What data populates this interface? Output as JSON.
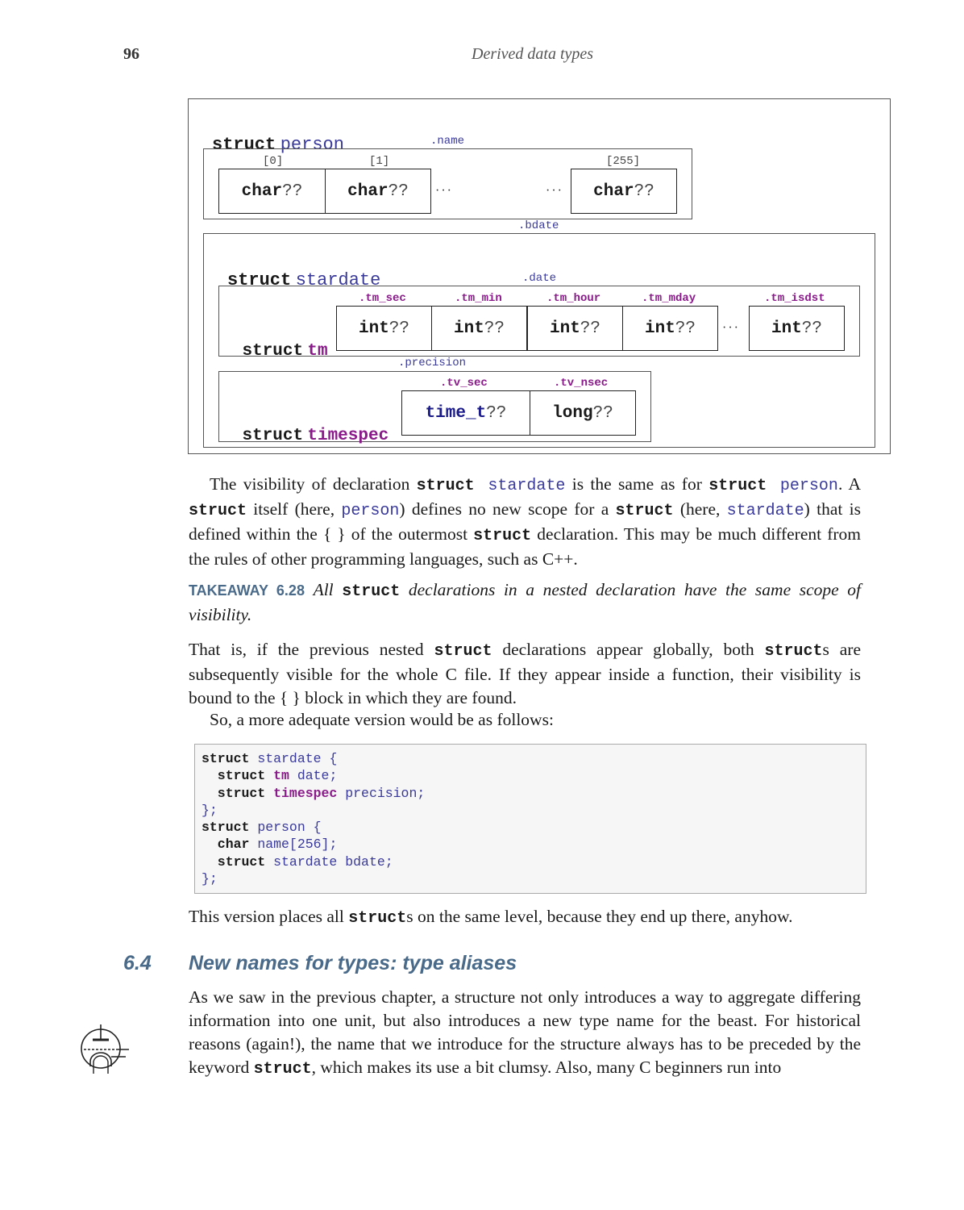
{
  "header": {
    "page_number": "96",
    "chapter_title": "Derived data types"
  },
  "diagram": {
    "outer_struct": {
      "keyword": "struct",
      "name": "person"
    },
    "name_field": {
      "label": ".name",
      "indices": [
        "[0]",
        "[1]",
        "[255]"
      ],
      "cells": [
        {
          "type": "char",
          "value": "??"
        },
        {
          "type": "char",
          "value": "??"
        },
        {
          "type": "char",
          "value": "??"
        }
      ],
      "ellipsis": "···"
    },
    "bdate_field": {
      "label": ".bdate",
      "keyword": "struct",
      "name": "stardate",
      "date_field": {
        "label": ".date",
        "keyword": "struct",
        "tag": "tm",
        "members": [
          {
            "label": ".tm_sec",
            "type": "int",
            "value": "??"
          },
          {
            "label": ".tm_min",
            "type": "int",
            "value": "??"
          },
          {
            "label": ".tm_hour",
            "type": "int",
            "value": "??"
          },
          {
            "label": ".tm_mday",
            "type": "int",
            "value": "??"
          },
          {
            "label": ".tm_isdst",
            "type": "int",
            "value": "??"
          }
        ],
        "ellipsis": "···"
      },
      "precision_field": {
        "label": ".precision",
        "keyword": "struct",
        "tag": "timespec",
        "members": [
          {
            "label": ".tv_sec",
            "type": "time_t",
            "value": "??"
          },
          {
            "label": ".tv_nsec",
            "type": "long",
            "value": "??"
          }
        ]
      }
    }
  },
  "paragraph1": {
    "t1": "The visibility of declaration ",
    "k1": "struct",
    "i1": "stardate",
    "t2": " is the same as for ",
    "k2": "struct",
    "i2": "person",
    "t3": ". A ",
    "k3": "struct",
    "t4": " itself (here, ",
    "i3": "person",
    "t5": ") defines no new scope for a ",
    "k4": "struct",
    "t6": " (here, ",
    "i4": "stardate",
    "t7": ") that is defined within the { } of the outermost ",
    "k5": "struct",
    "t8": " declaration.  This may be much different from the rules of other programming languages, such as C++."
  },
  "takeaway": {
    "label": "TAKEAWAY 6.28",
    "t1": "All ",
    "k1": "struct",
    "t2": " declarations in a nested declaration have the same scope of visibility."
  },
  "paragraph2": {
    "t1": "That is, if the previous nested ",
    "k1": "struct",
    "t2": " declarations appear globally, both ",
    "k2": "struct",
    "t3": "s are subsequently visible for the whole C file. If they appear inside a function, their visibility is bound to the { } block in which they are found."
  },
  "paragraph3": "So, a more adequate version would be as follows:",
  "code": {
    "lines": [
      [
        {
          "c": "kw",
          "t": "struct"
        },
        {
          "c": "id",
          "t": " stardate {"
        }
      ],
      [
        {
          "c": "kw",
          "t": "  struct"
        },
        {
          "c": "tag",
          "t": " tm"
        },
        {
          "c": "id",
          "t": " date;"
        }
      ],
      [
        {
          "c": "kw",
          "t": "  struct"
        },
        {
          "c": "tag",
          "t": " timespec"
        },
        {
          "c": "id",
          "t": " precision;"
        }
      ],
      [
        {
          "c": "id",
          "t": "};"
        }
      ],
      [
        {
          "c": "kw",
          "t": "struct"
        },
        {
          "c": "id",
          "t": " person {"
        }
      ],
      [
        {
          "c": "kw",
          "t": "  char"
        },
        {
          "c": "id",
          "t": " name[256];"
        }
      ],
      [
        {
          "c": "kw",
          "t": "  struct"
        },
        {
          "c": "id",
          "t": " stardate bdate;"
        }
      ],
      [
        {
          "c": "id",
          "t": "};"
        }
      ]
    ]
  },
  "paragraph4": {
    "t1": "This version places all ",
    "k1": "struct",
    "t2": "s on the same level, because they end up there, anyhow."
  },
  "section": {
    "number": "6.4",
    "title": "New names for types: type aliases"
  },
  "paragraph5": {
    "t1": "As we saw in the previous chapter, a structure not only introduces a way to aggregate differing information into one unit, but also introduces a new type name for the beast.  For historical reasons (again!), the name that we introduce for the structure always has to be preceded by the keyword ",
    "k1": "struct",
    "t2": ", which makes its use a bit clumsy.  Also, many C beginners run into"
  },
  "margin_icon": "vacuum-tube-icon"
}
